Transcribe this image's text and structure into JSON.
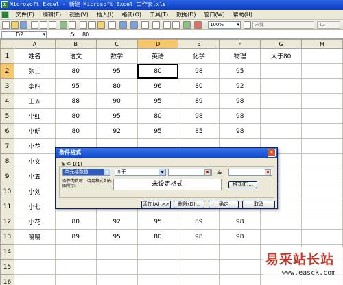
{
  "window": {
    "title": "Microsoft Excel - 新建 Microsoft Excel 工作表.xls"
  },
  "menu": [
    "文件(F)",
    "编辑(E)",
    "视图(V)",
    "插入(I)",
    "格式(O)",
    "工具(T)",
    "数据(D)",
    "窗口(W)",
    "帮助(H)"
  ],
  "toolbar": {
    "zoom": "100%",
    "font": "宋体",
    "size": "12"
  },
  "formula_bar": {
    "name_box": "D2",
    "fx": "fx",
    "value": "80"
  },
  "columns": [
    "A",
    "B",
    "C",
    "D",
    "E",
    "F",
    "G",
    "H"
  ],
  "rows": [
    {
      "num": "1",
      "cells": [
        "姓名",
        "语文",
        "数学",
        "英语",
        "化学",
        "物理",
        "大于80",
        ""
      ]
    },
    {
      "num": "2",
      "cells": [
        "张三",
        "80",
        "95",
        "80",
        "98",
        "95",
        "",
        ""
      ]
    },
    {
      "num": "3",
      "cells": [
        "李四",
        "95",
        "80",
        "96",
        "80",
        "92",
        "",
        ""
      ]
    },
    {
      "num": "4",
      "cells": [
        "王五",
        "88",
        "90",
        "95",
        "89",
        "98",
        "",
        ""
      ]
    },
    {
      "num": "5",
      "cells": [
        "小红",
        "80",
        "95",
        "80",
        "98",
        "98",
        "",
        ""
      ]
    },
    {
      "num": "6",
      "cells": [
        "小明",
        "80",
        "92",
        "95",
        "85",
        "98",
        "",
        ""
      ]
    },
    {
      "num": "7",
      "cells": [
        "小花",
        "",
        "",
        "",
        "",
        "",
        "",
        ""
      ]
    },
    {
      "num": "8",
      "cells": [
        "小文",
        "",
        "",
        "",
        "",
        "",
        "",
        ""
      ]
    },
    {
      "num": "9",
      "cells": [
        "小五",
        "",
        "",
        "",
        "",
        "",
        "",
        ""
      ]
    },
    {
      "num": "10",
      "cells": [
        "小刘",
        "",
        "",
        "",
        "",
        "",
        "",
        ""
      ]
    },
    {
      "num": "11",
      "cells": [
        "小七",
        "",
        "",
        "",
        "",
        "",
        "",
        ""
      ]
    },
    {
      "num": "12",
      "cells": [
        "小花",
        "80",
        "92",
        "95",
        "89",
        "98",
        "",
        ""
      ]
    },
    {
      "num": "13",
      "cells": [
        "晓晓",
        "89",
        "95",
        "80",
        "98",
        "98",
        "",
        ""
      ]
    },
    {
      "num": "14",
      "cells": [
        "",
        "",
        "",
        "",
        "",
        "",
        "",
        ""
      ]
    },
    {
      "num": "15",
      "cells": [
        "",
        "",
        "",
        "",
        "",
        "",
        "",
        ""
      ]
    },
    {
      "num": "16",
      "cells": [
        "",
        "",
        "",
        "",
        "",
        "",
        "",
        ""
      ]
    }
  ],
  "dialog": {
    "title": "条件格式",
    "condition_label": "条件 1(1)",
    "condition_type": "单元格数值",
    "operator": "介于",
    "value1": "",
    "and_label": "与",
    "value2": "",
    "hint": "条件为真时，待用格式如右图所示:",
    "preview": "未设定格式",
    "format_button": "格式(F)...",
    "add_button": "添加(A) >>",
    "delete_button": "删除(D)...",
    "ok_button": "确定",
    "cancel_button": "取消"
  },
  "watermark": {
    "text": "易采站长站",
    "url": "www.easck.com"
  }
}
